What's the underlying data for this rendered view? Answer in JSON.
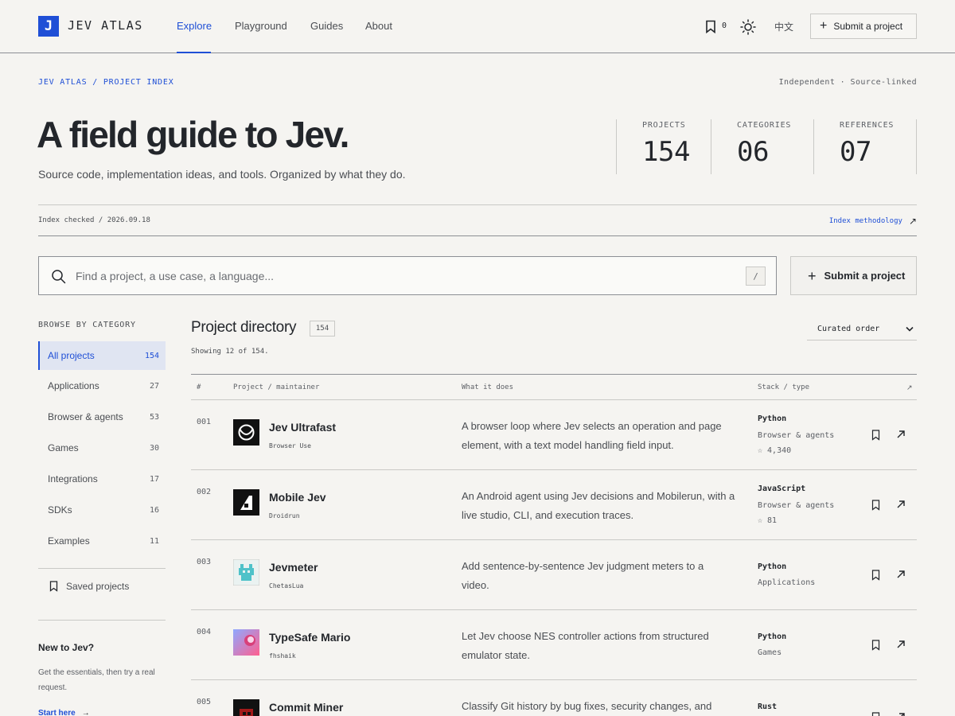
{
  "brand": {
    "mark": "J",
    "name": "JEV ATLAS"
  },
  "nav": {
    "explore": "Explore",
    "playground": "Playground",
    "guides": "Guides",
    "about": "About"
  },
  "header": {
    "saved_count": "0",
    "language": "中文",
    "submit": "Submit a project"
  },
  "breadcrumb": "JEV ATLAS / PROJECT INDEX",
  "meta": "Independent · Source-linked",
  "hero": {
    "title": "A field guide to Jev.",
    "subtitle": "Source code, implementation ideas, and tools. Organized by what they do."
  },
  "stats": [
    {
      "label": "PROJECTS",
      "value": "154"
    },
    {
      "label": "CATEGORIES",
      "value": "06"
    },
    {
      "label": "REFERENCES",
      "value": "07"
    }
  ],
  "index": {
    "checked": "Index checked / 2026.09.18",
    "methodology": "Index methodology"
  },
  "search": {
    "placeholder": "Find a project, a use case, a language...",
    "shortcut": "/"
  },
  "submit_main": "Submit a project",
  "sidebar": {
    "heading": "BROWSE BY CATEGORY",
    "items": [
      {
        "label": "All projects",
        "count": "154"
      },
      {
        "label": "Applications",
        "count": "27"
      },
      {
        "label": "Browser & agents",
        "count": "53"
      },
      {
        "label": "Games",
        "count": "30"
      },
      {
        "label": "Integrations",
        "count": "17"
      },
      {
        "label": "SDKs",
        "count": "16"
      },
      {
        "label": "Examples",
        "count": "11"
      }
    ],
    "saved": "Saved projects",
    "new_title": "New to Jev?",
    "new_body": "Get the essentials, then try a real request.",
    "start": "Start here"
  },
  "directory": {
    "title": "Project directory",
    "count": "154",
    "showing": "Showing 12 of 154.",
    "sort": "Curated order",
    "columns": {
      "num": "#",
      "project": "Project / maintainer",
      "what": "What it does",
      "stack": "Stack / type",
      "link": "↗"
    },
    "rows": [
      {
        "num": "001",
        "name": "Jev Ultrafast",
        "maintainer": "Browser Use",
        "desc": "A browser loop where Jev selects an operation and page element, with a text model handling field input.",
        "lang": "Python",
        "category": "Browser & agents",
        "stars": "☆ 4,340"
      },
      {
        "num": "002",
        "name": "Mobile Jev",
        "maintainer": "Droidrun",
        "desc": "An Android agent using Jev decisions and Mobilerun, with a live studio, CLI, and execution traces.",
        "lang": "JavaScript",
        "category": "Browser & agents",
        "stars": "☆ 81"
      },
      {
        "num": "003",
        "name": "Jevmeter",
        "maintainer": "ChetasLua",
        "desc": "Add sentence-by-sentence Jev judgment meters to a video.",
        "lang": "Python",
        "category": "Applications",
        "stars": ""
      },
      {
        "num": "004",
        "name": "TypeSafe Mario",
        "maintainer": "fhshaik",
        "desc": "Let Jev choose NES controller actions from structured emulator state.",
        "lang": "Python",
        "category": "Games",
        "stars": ""
      },
      {
        "num": "005",
        "name": "Commit Miner",
        "maintainer": "",
        "desc": "Classify Git history by bug fixes, security changes, and",
        "lang": "Rust",
        "category": "",
        "stars": ""
      }
    ]
  },
  "colors": {
    "accent": "#1f4fd6",
    "background": "#f5f4f1",
    "text": "#23262b"
  }
}
